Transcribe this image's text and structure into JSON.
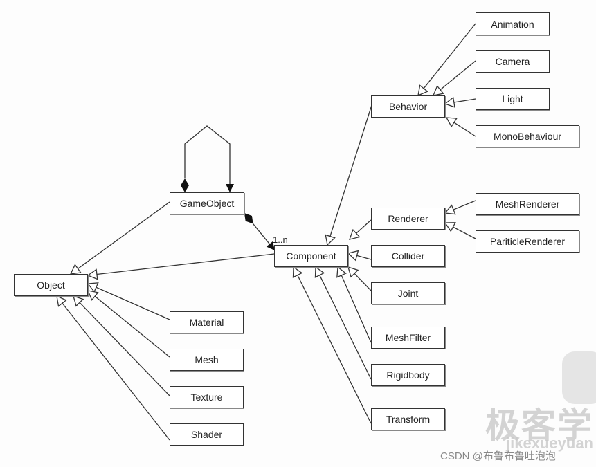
{
  "diagram": {
    "nodes": {
      "object": "Object",
      "gameobject": "GameObject",
      "component": "Component",
      "material": "Material",
      "mesh": "Mesh",
      "texture": "Texture",
      "shader": "Shader",
      "behavior": "Behavior",
      "animation": "Animation",
      "camera": "Camera",
      "light": "Light",
      "monobehaviour": "MonoBehaviour",
      "renderer": "Renderer",
      "meshrenderer": "MeshRenderer",
      "particlerenderer": "PariticleRenderer",
      "collider": "Collider",
      "joint": "Joint",
      "meshfilter": "MeshFilter",
      "rigidbody": "Rigidbody",
      "transform": "Transform"
    },
    "multiplicity": "1..n",
    "relations": {
      "inheritance": [
        [
          "gameobject",
          "object"
        ],
        [
          "component",
          "object"
        ],
        [
          "material",
          "object"
        ],
        [
          "mesh",
          "object"
        ],
        [
          "texture",
          "object"
        ],
        [
          "shader",
          "object"
        ],
        [
          "behavior",
          "component"
        ],
        [
          "renderer",
          "component"
        ],
        [
          "collider",
          "component"
        ],
        [
          "joint",
          "component"
        ],
        [
          "meshfilter",
          "component"
        ],
        [
          "rigidbody",
          "component"
        ],
        [
          "transform",
          "component"
        ],
        [
          "animation",
          "behavior"
        ],
        [
          "camera",
          "behavior"
        ],
        [
          "light",
          "behavior"
        ],
        [
          "monobehaviour",
          "behavior"
        ],
        [
          "meshrenderer",
          "renderer"
        ],
        [
          "particlerenderer",
          "renderer"
        ]
      ],
      "composition": [
        [
          "gameobject",
          "component"
        ],
        [
          "gameobject",
          "gameobject"
        ]
      ]
    }
  },
  "watermark": {
    "logo_text": "极客学",
    "logo_subtext": "jikexueyuan",
    "credit": "CSDN @布鲁布鲁吐泡泡"
  }
}
